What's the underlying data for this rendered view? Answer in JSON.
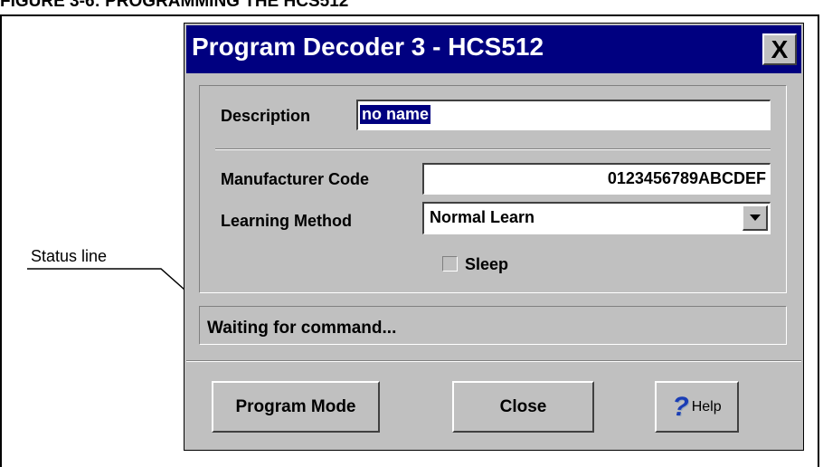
{
  "figure": {
    "title": "FIGURE 3-6:    PROGRAMMING THE HCS512"
  },
  "callout": {
    "status_label": "Status line"
  },
  "dialog": {
    "title": "Program Decoder 3 - HCS512",
    "close_glyph": "X",
    "description_label": "Description",
    "description_value": "no name",
    "manufacturer_code_label": "Manufacturer Code",
    "manufacturer_code_value": "0123456789ABCDEF",
    "learning_method_label": "Learning Method",
    "learning_method_value": "Normal Learn",
    "sleep_label": "Sleep",
    "sleep_checked": false,
    "status_text": "Waiting for command...",
    "buttons": {
      "program_mode": "Program Mode",
      "close": "Close",
      "help": "Help"
    }
  },
  "colors": {
    "titlebar": "#000080",
    "face": "#c0c0c0"
  }
}
